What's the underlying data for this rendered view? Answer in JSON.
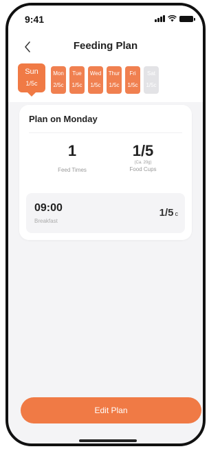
{
  "status_bar": {
    "time": "9:41",
    "icons": [
      "signal-icon",
      "wifi-icon",
      "battery-icon"
    ]
  },
  "nav": {
    "title": "Feeding Plan",
    "back_icon": "chevron-left-icon"
  },
  "days": [
    {
      "name": "Sun",
      "amount": "1/5c",
      "state": "selected"
    },
    {
      "name": "Mon",
      "amount": "2/5c",
      "state": "active"
    },
    {
      "name": "Tue",
      "amount": "1/5c",
      "state": "active"
    },
    {
      "name": "Wed",
      "amount": "1/5c",
      "state": "active"
    },
    {
      "name": "Thur",
      "amount": "1/5c",
      "state": "active"
    },
    {
      "name": "Fri",
      "amount": "1/5c",
      "state": "active"
    },
    {
      "name": "Sat",
      "amount": "1/5c",
      "state": "disabled"
    }
  ],
  "plan": {
    "title": "Plan on Monday",
    "feed_times_value": "1",
    "feed_times_label": "Feed Times",
    "food_cups_value": "1/5",
    "food_cups_sub": "(Ca. 20g)",
    "food_cups_label": "Food Cups",
    "meals": [
      {
        "time": "09:00",
        "name": "Breakfast",
        "amount": "1/5",
        "unit": "c"
      }
    ]
  },
  "edit_button_label": "Edit Plan",
  "colors": {
    "accent": "#f07a45",
    "chip": "#f08050",
    "disabled_chip": "#e3e3e6",
    "background": "#f4f4f6"
  }
}
